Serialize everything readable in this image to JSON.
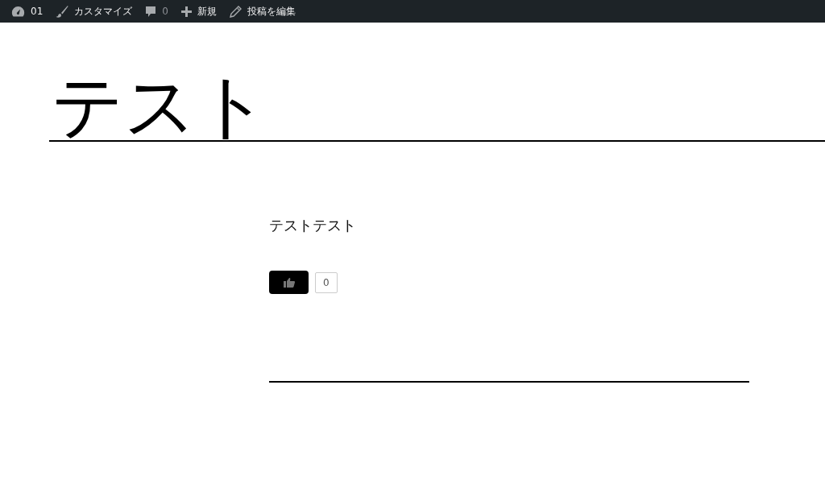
{
  "admin_bar": {
    "items": [
      {
        "kind": "dashboard",
        "label": "01"
      },
      {
        "kind": "brush",
        "label": "カスタマイズ"
      },
      {
        "kind": "comment",
        "label": "0"
      },
      {
        "kind": "plus",
        "label": "新規"
      },
      {
        "kind": "pencil",
        "label": "投稿を編集"
      }
    ]
  },
  "page_title": "テスト",
  "post": {
    "body": "テストテスト",
    "like_count": "0"
  }
}
